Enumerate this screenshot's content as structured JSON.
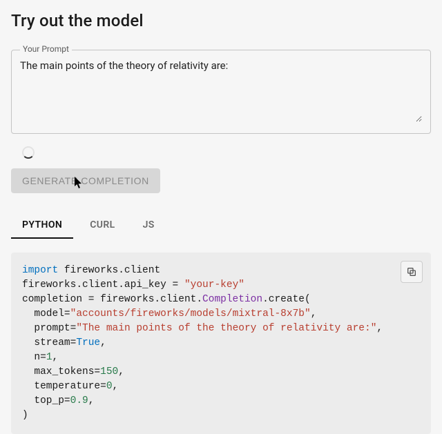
{
  "title": "Try out the model",
  "promptField": {
    "label": "Your Prompt",
    "value": "The main points of the theory of relativity are:"
  },
  "loading": true,
  "generateButton": {
    "label": "GENERATE COMPLETION",
    "disabled": true
  },
  "tabs": [
    {
      "id": "python",
      "label": "PYTHON",
      "active": true
    },
    {
      "id": "curl",
      "label": "CURL",
      "active": false
    },
    {
      "id": "js",
      "label": "JS",
      "active": false
    }
  ],
  "code": {
    "line1_kw": "import",
    "line1_rest": " fireworks.client",
    "line2_pre": "fireworks.client.api_key = ",
    "line2_str": "\"your-key\"",
    "line3_pre": "completion = fireworks.client.",
    "line3_fn": "Completion",
    "line3_post": ".create(",
    "arg_model_key": "  model=",
    "arg_model_val": "\"accounts/fireworks/models/mixtral-8x7b\"",
    "arg_prompt_key": "  prompt=",
    "arg_prompt_val": "\"The main points of the theory of relativity are:\"",
    "arg_stream_key": "  stream=",
    "arg_stream_val": "True",
    "arg_n_key": "  n=",
    "arg_n_val": "1",
    "arg_max_key": "  max_tokens=",
    "arg_max_val": "150",
    "arg_temp_key": "  temperature=",
    "arg_temp_val": "0",
    "arg_topp_key": "  top_p=",
    "arg_topp_val": "0.9",
    "comma": ",",
    "close": ")"
  },
  "icons": {
    "copy": "copy-icon",
    "cursor": "cursor-icon"
  }
}
